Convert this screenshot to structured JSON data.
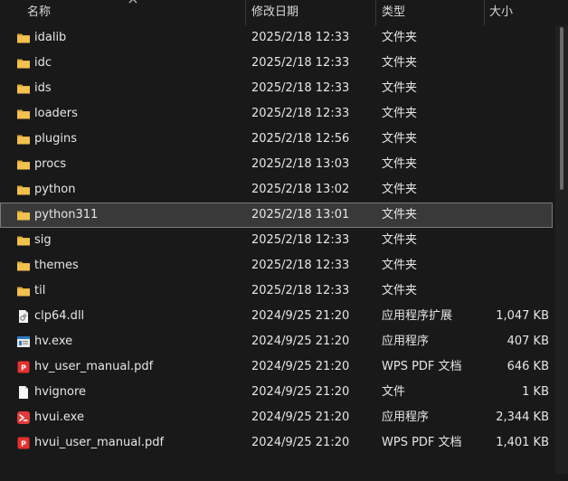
{
  "columns": {
    "name": "名称",
    "modified": "修改日期",
    "type": "类型",
    "size": "大小"
  },
  "files": [
    {
      "name": "idalib",
      "date": "2025/2/18 12:33",
      "type": "文件夹",
      "size": "",
      "icon": "folder-icon"
    },
    {
      "name": "idc",
      "date": "2025/2/18 12:33",
      "type": "文件夹",
      "size": "",
      "icon": "folder-icon"
    },
    {
      "name": "ids",
      "date": "2025/2/18 12:33",
      "type": "文件夹",
      "size": "",
      "icon": "folder-icon"
    },
    {
      "name": "loaders",
      "date": "2025/2/18 12:33",
      "type": "文件夹",
      "size": "",
      "icon": "folder-icon"
    },
    {
      "name": "plugins",
      "date": "2025/2/18 12:56",
      "type": "文件夹",
      "size": "",
      "icon": "folder-icon"
    },
    {
      "name": "procs",
      "date": "2025/2/18 13:03",
      "type": "文件夹",
      "size": "",
      "icon": "folder-icon"
    },
    {
      "name": "python",
      "date": "2025/2/18 13:02",
      "type": "文件夹",
      "size": "",
      "icon": "folder-icon"
    },
    {
      "name": "python311",
      "date": "2025/2/18 13:01",
      "type": "文件夹",
      "size": "",
      "icon": "folder-icon",
      "selected": true
    },
    {
      "name": "sig",
      "date": "2025/2/18 12:33",
      "type": "文件夹",
      "size": "",
      "icon": "folder-icon"
    },
    {
      "name": "themes",
      "date": "2025/2/18 12:33",
      "type": "文件夹",
      "size": "",
      "icon": "folder-icon"
    },
    {
      "name": "til",
      "date": "2025/2/18 12:33",
      "type": "文件夹",
      "size": "",
      "icon": "folder-icon"
    },
    {
      "name": "clp64.dll",
      "date": "2024/9/25 21:20",
      "type": "应用程序扩展",
      "size": "1,047 KB",
      "icon": "dll-file-icon"
    },
    {
      "name": "hv.exe",
      "date": "2024/9/25 21:20",
      "type": "应用程序",
      "size": "407 KB",
      "icon": "exe-app-icon"
    },
    {
      "name": "hv_user_manual.pdf",
      "date": "2024/9/25 21:20",
      "type": "WPS PDF 文档",
      "size": "646 KB",
      "icon": "pdf-file-icon"
    },
    {
      "name": "hvignore",
      "date": "2024/9/25 21:20",
      "type": "文件",
      "size": "1 KB",
      "icon": "blank-file-icon"
    },
    {
      "name": "hvui.exe",
      "date": "2024/9/25 21:20",
      "type": "应用程序",
      "size": "2,344 KB",
      "icon": "ida-app-icon"
    },
    {
      "name": "hvui_user_manual.pdf",
      "date": "2024/9/25 21:20",
      "type": "WPS PDF 文档",
      "size": "1,401 KB",
      "icon": "pdf-file-icon"
    }
  ],
  "colors": {
    "background": "#191919",
    "selected_row": "#393939",
    "folder": "#f2c14e",
    "pdf": "#e5312f"
  }
}
